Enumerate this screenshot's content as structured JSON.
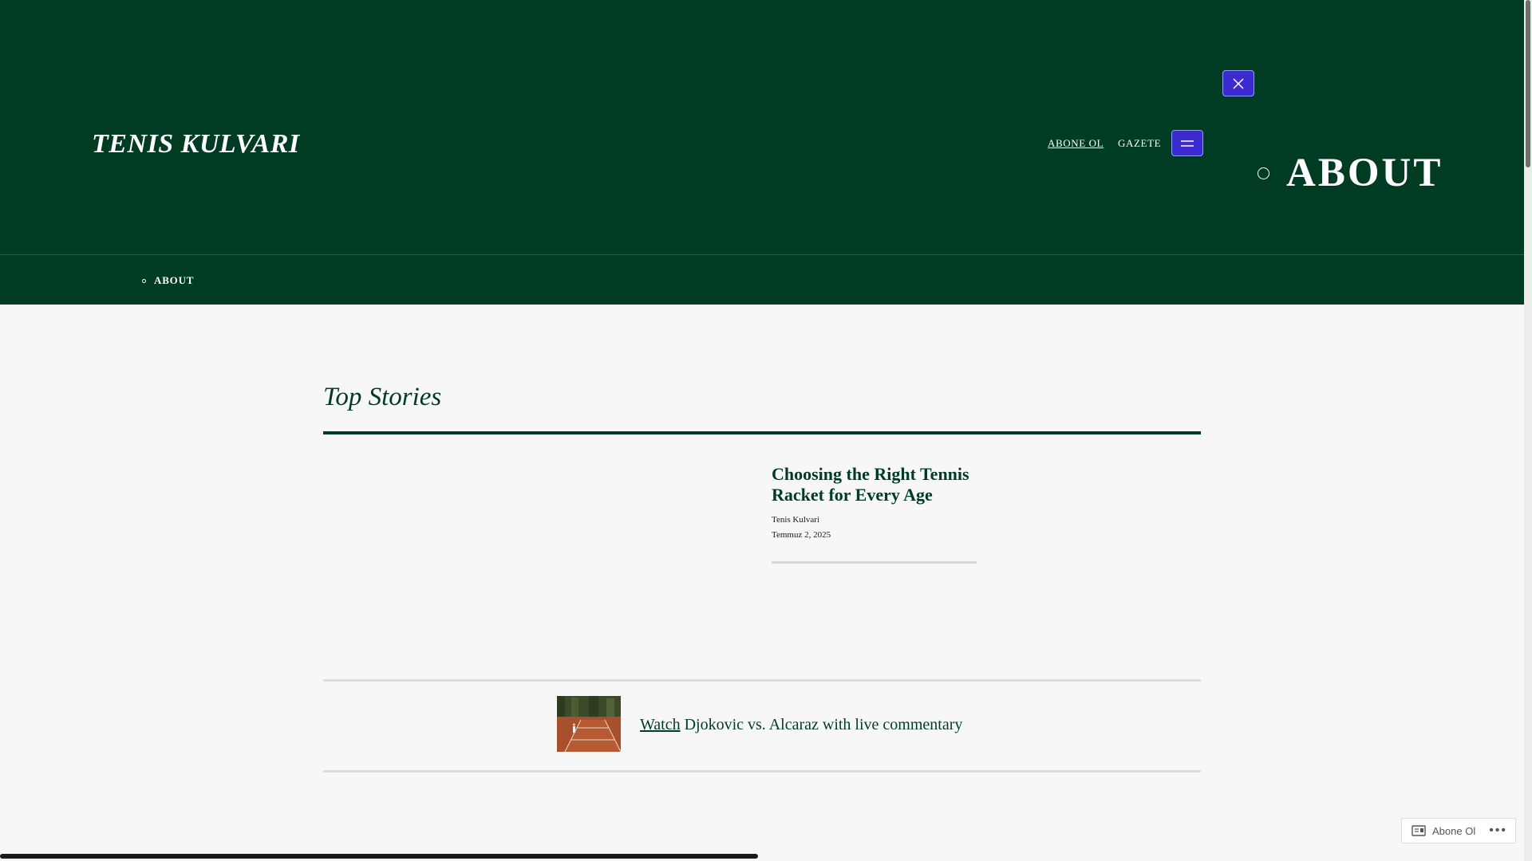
{
  "header": {
    "site_title": "TENIS KULVARI",
    "nav": [
      {
        "label": "ABONE OL"
      },
      {
        "label": "GAZETE"
      }
    ],
    "about_big_label": "ABOUT",
    "icons": {
      "menu": "hamburger-icon",
      "close": "close-icon"
    },
    "colors": {
      "header_bg": "#003c23",
      "button_bg": "#3b2bd1"
    }
  },
  "subnav": {
    "items": [
      {
        "label": "ABOUT"
      }
    ]
  },
  "main": {
    "section_title": "Top Stories",
    "featured": {
      "title": "Choosing the Right Tennis Racket for Every Age",
      "author": "Tenis Kulvari",
      "date": "Temmuz 2, 2025"
    },
    "watch": {
      "link_text": "Watch",
      "rest_text": " Djokovic vs. Alcaraz with live commentary"
    }
  },
  "subscribe_bar": {
    "label": "Abone Ol",
    "more": "•••"
  }
}
